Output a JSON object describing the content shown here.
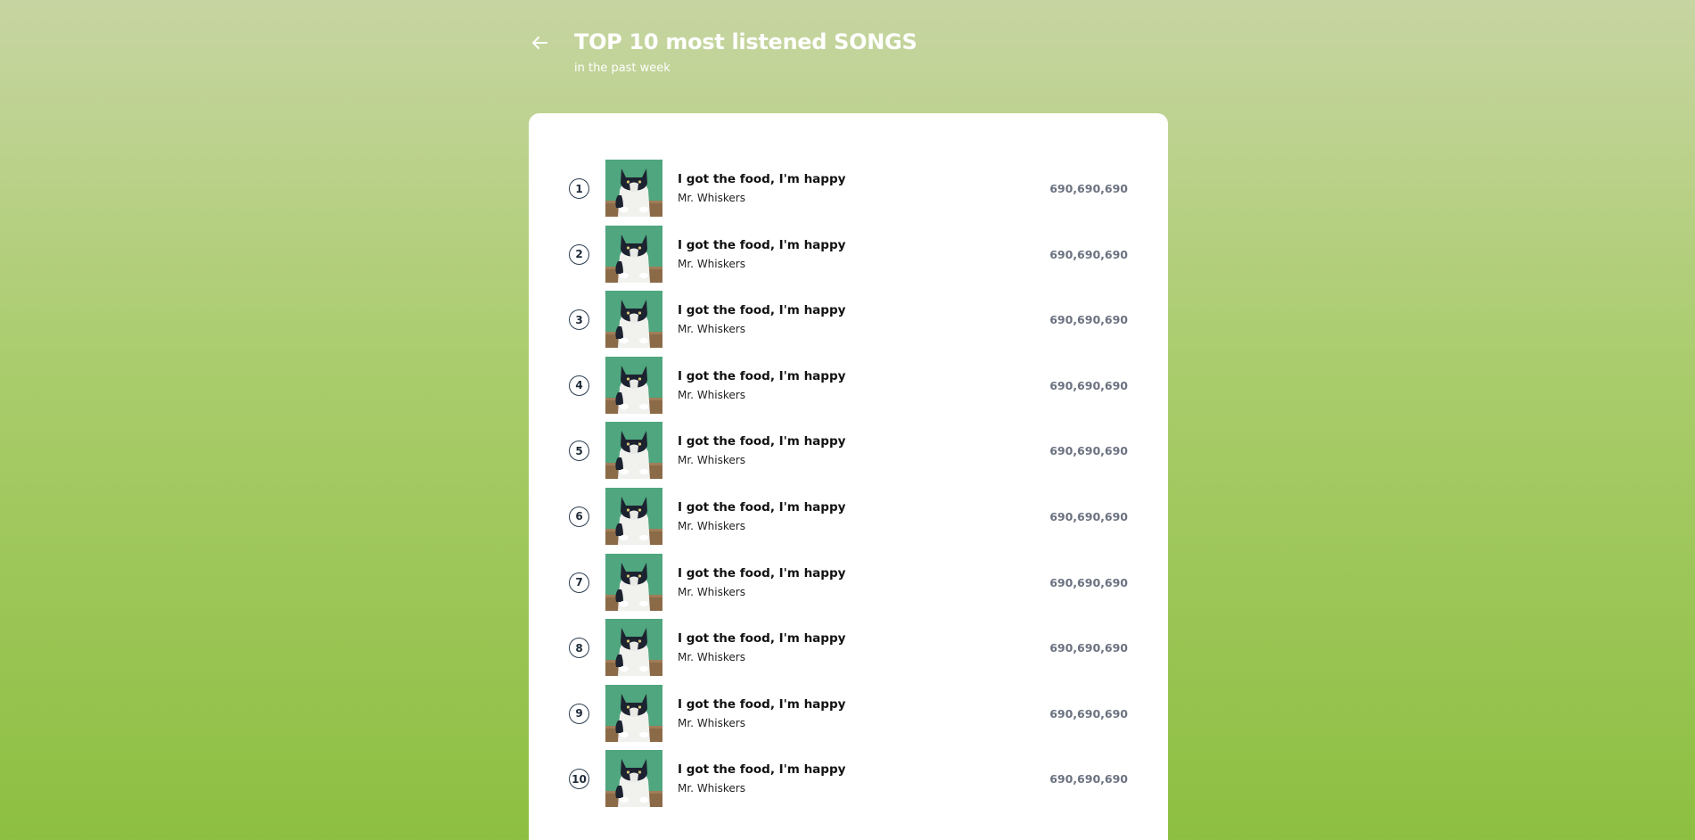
{
  "header": {
    "title": "TOP 10 most listened SONGS",
    "subtitle": "in the past week",
    "back_icon": "arrow-left-icon"
  },
  "colors": {
    "background_top": "#c7d5a2",
    "background_bottom": "#8dbf41",
    "card": "#ffffff",
    "plays_text": "#6b7280"
  },
  "songs": [
    {
      "rank": "1",
      "title": "I got the food, I'm happy",
      "artist": "Mr. Whiskers",
      "plays": "690,690,690",
      "cover_icon": "cat-cover-image"
    },
    {
      "rank": "2",
      "title": "I got the food, I'm happy",
      "artist": "Mr. Whiskers",
      "plays": "690,690,690",
      "cover_icon": "cat-cover-image"
    },
    {
      "rank": "3",
      "title": "I got the food, I'm happy",
      "artist": "Mr. Whiskers",
      "plays": "690,690,690",
      "cover_icon": "cat-cover-image"
    },
    {
      "rank": "4",
      "title": "I got the food, I'm happy",
      "artist": "Mr. Whiskers",
      "plays": "690,690,690",
      "cover_icon": "cat-cover-image"
    },
    {
      "rank": "5",
      "title": "I got the food, I'm happy",
      "artist": "Mr. Whiskers",
      "plays": "690,690,690",
      "cover_icon": "cat-cover-image"
    },
    {
      "rank": "6",
      "title": "I got the food, I'm happy",
      "artist": "Mr. Whiskers",
      "plays": "690,690,690",
      "cover_icon": "cat-cover-image"
    },
    {
      "rank": "7",
      "title": "I got the food, I'm happy",
      "artist": "Mr. Whiskers",
      "plays": "690,690,690",
      "cover_icon": "cat-cover-image"
    },
    {
      "rank": "8",
      "title": "I got the food, I'm happy",
      "artist": "Mr. Whiskers",
      "plays": "690,690,690",
      "cover_icon": "cat-cover-image"
    },
    {
      "rank": "9",
      "title": "I got the food, I'm happy",
      "artist": "Mr. Whiskers",
      "plays": "690,690,690",
      "cover_icon": "cat-cover-image"
    },
    {
      "rank": "10",
      "title": "I got the food, I'm happy",
      "artist": "Mr. Whiskers",
      "plays": "690,690,690",
      "cover_icon": "cat-cover-image"
    }
  ]
}
